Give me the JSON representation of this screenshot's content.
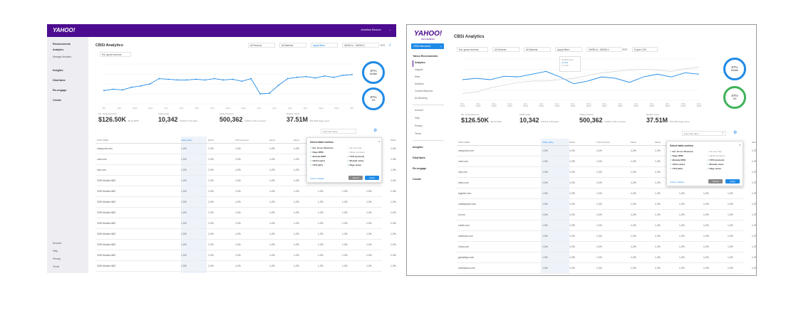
{
  "colors": {
    "brand": "#4d0c8f",
    "accent": "#1f8ae6",
    "donut_mobile": "#1f8ae6",
    "donut_us": "#3fb25a"
  },
  "left": {
    "logo": "YAHOO!",
    "user": "Jonathan Monzon",
    "page_title": "CBSi Analytics",
    "metric_select": "Est. gross revenue",
    "filters": {
      "devices": "All Devices",
      "markets": "All Markets",
      "apply": "Apply filters",
      "date": "06/05/14 - 06/05/14",
      "tz": "EST"
    },
    "nav": {
      "recommends": "Recommends",
      "analytics": "Analytics",
      "manage_modules": "Manage Modules",
      "insights": "Insights",
      "distribute": "Distribute",
      "reengage": "Re-engage",
      "create": "Create",
      "account": "Account",
      "help": "Help",
      "privacy": "Privacy",
      "terms": "Terms"
    },
    "donuts": [
      {
        "value": "87%",
        "label": "Mobile"
      },
      {
        "value": "87%",
        "label": "US"
      }
    ],
    "stats": [
      {
        "label": "Est. Gross Revenue",
        "value": "$126.50K",
        "sub": "$0.16 RPM"
      },
      {
        "label": "Clicks (ads)",
        "value": "10,342",
        "sub": "0.831% CTR (ads)"
      },
      {
        "label": "Clicks (content)",
        "value": "500,362",
        "sub": "0.831% CTR (content)"
      },
      {
        "label": "Module Views",
        "value": "37.51M",
        "sub": "351.00M Page views"
      }
    ],
    "search_placeholder": "enter site name",
    "table": {
      "headers": [
        "SITE NAME",
        "Clicks (ads)",
        "Metric",
        "CTR (content)",
        "Metric",
        "Metric",
        "Metric",
        "Metric",
        "Metric",
        "Metric"
      ],
      "rows": [
        [
          "cbssports.com",
          "1.2%",
          "1.2%",
          "1.2%",
          "1.2%",
          "1.2%",
          "1.2%",
          "1.2%",
          "1.2%",
          "1.2%"
        ],
        [
          "cnet.com",
          "1.2%",
          "1.2%",
          "1.2%",
          "1.2%",
          "1.2%",
          "1.2%",
          "1.2%",
          "1.2%",
          "1.2%"
        ],
        [
          "cbs.com",
          "1.2%",
          "1.2%",
          "1.2%",
          "1.2%",
          "1.2%",
          "1.2%",
          "1.2%",
          "1.2%",
          "1.2%"
        ],
        [
          "CBS Module ABC",
          "1.2%",
          "1.2%",
          "1.2%",
          "1.2%",
          "1.2%",
          "1.2%",
          "1.2%",
          "1.2%",
          "1.2%"
        ],
        [
          "CBS Module ABC",
          "1.2%",
          "1.2%",
          "1.2%",
          "1.2%",
          "1.2%",
          "1.2%",
          "1.2%",
          "1.2%",
          "1.2%"
        ],
        [
          "CBS Module ABC",
          "1.2%",
          "1.2%",
          "1.2%",
          "1.2%",
          "1.2%",
          "1.2%",
          "1.2%",
          "1.2%",
          "1.2%"
        ],
        [
          "CBS Module ABC",
          "1.2%",
          "1.2%",
          "1.2%",
          "1.2%",
          "1.2%",
          "1.2%",
          "1.2%",
          "1.2%",
          "1.2%"
        ],
        [
          "CBS Module ABC",
          "1.2%",
          "1.2%",
          "1.2%",
          "1.2%",
          "1.2%",
          "1.2%",
          "1.2%",
          "1.2%",
          "1.2%"
        ],
        [
          "CBS Module ABC",
          "1.2%",
          "1.2%",
          "1.2%",
          "1.2%",
          "1.2%",
          "1.2%",
          "1.2%",
          "1.2%",
          "1.2%"
        ],
        [
          "CBS Module ABC",
          "1.2%",
          "1.2%",
          "1.2%",
          "1.2%",
          "1.2%",
          "1.2%",
          "1.2%",
          "1.2%",
          "1.2%"
        ],
        [
          "CBS Module ABC",
          "1.2%",
          "1.2%",
          "1.2%",
          "1.2%",
          "1.2%",
          "1.2%",
          "1.2%",
          "1.2%",
          "1.2%"
        ],
        [
          "CBS Module ABC",
          "1.2%",
          "1.2%",
          "1.2%",
          "1.2%",
          "1.2%",
          "1.2%",
          "1.2%",
          "1.2%",
          "1.2%"
        ]
      ]
    },
    "popup": {
      "title": "Select table metrics",
      "items_left": [
        "Est. Gross Revenue",
        "Page RPM",
        "Module RPM",
        "Clicks (ads)",
        "CTR (ads)"
      ],
      "items_right": [
        "Ad view rate",
        "Clicks (content)",
        "CTR (content)",
        "Module views",
        "Page views"
      ],
      "right_checked": [
        false,
        false,
        true,
        true,
        true
      ],
      "reset": "reset to default",
      "cancel": "Cancel",
      "apply": "Apply"
    },
    "x_ticks": [
      "6am",
      "8am",
      "10am",
      "12pm",
      "2pm",
      "4pm",
      "6pm",
      "8pm",
      "10pm",
      "12am",
      "2am",
      "4am",
      "6am",
      "8am",
      "10am",
      "12pm",
      "2pm"
    ]
  },
  "right": {
    "logo": "YAHOO!",
    "logo_sub": "RECOMMENDS",
    "account_select": "CBSi Interactive",
    "page_title": "CBSi Analytics",
    "metric_select": "Est. gross revenue",
    "filters": {
      "devices": "All Devices",
      "markets": "All Markets",
      "apply": "Apply filters",
      "date": "06/05/14 - 06/05/14",
      "tz": "EST",
      "export": "Export CSV"
    },
    "nav": {
      "head": "Yahoo Recommends",
      "items": [
        "Analytics",
        "Insights",
        "Sites",
        "Modules",
        "Content Beacons",
        "Ad Blocking"
      ],
      "items2": [
        "Account",
        "Help",
        "Privacy",
        "Terms"
      ],
      "sections": [
        "Insights",
        "Distribute",
        "Re-engage",
        "Create"
      ]
    },
    "tooltip": {
      "date": "06/05/14 8pm",
      "a": "6,871",
      "b": "4,760"
    },
    "donuts": [
      {
        "value": "87%",
        "label": "Mobile"
      },
      {
        "value": "87%",
        "label": "US"
      }
    ],
    "stats": [
      {
        "label": "Est. Gross Revenue",
        "value": "$126.50K",
        "sub": "$0.16 RPM"
      },
      {
        "label": "Clicks (ads)",
        "value": "10,342",
        "sub": "0.831% CTR (ads)"
      },
      {
        "label": "Clicks (content)",
        "value": "500,362",
        "sub": "0.831% CTR (content)"
      },
      {
        "label": "Module Views",
        "value": "37.51M",
        "sub": "351.00M Page views"
      }
    ],
    "search_placeholder": "enter site name",
    "table": {
      "headers": [
        "SITE NAME",
        "Clicks (ads)",
        "Metric",
        "CTR (content)",
        "Metric",
        "Metric",
        "Metric",
        "Metric",
        "Metric",
        "Metric"
      ],
      "rows": [
        [
          "cbssports.com",
          "1.2%",
          "1.2%",
          "1.2%",
          "1.2%",
          "1.2%",
          "1.2%",
          "1.2%",
          "1.2%",
          "1.2%"
        ],
        [
          "cnet.com",
          "1.2%",
          "1.2%",
          "1.2%",
          "1.2%",
          "1.2%",
          "1.2%",
          "1.2%",
          "1.2%",
          "1.2%"
        ],
        [
          "cbs.com",
          "1.2%",
          "1.2%",
          "1.2%",
          "1.2%",
          "1.2%",
          "1.2%",
          "1.2%",
          "1.2%",
          "1.2%"
        ],
        [
          "radio.com",
          "1.2%",
          "1.2%",
          "1.2%",
          "1.2%",
          "1.2%",
          "1.2%",
          "1.2%",
          "1.2%",
          "1.2%"
        ],
        [
          "tvguide.com",
          "1.2%",
          "1.2%",
          "1.2%",
          "1.2%",
          "1.2%",
          "1.2%",
          "1.2%",
          "1.2%",
          "1.2%"
        ],
        [
          "smartplanet.com",
          "1.2%",
          "1.2%",
          "1.2%",
          "1.2%",
          "1.2%",
          "1.2%",
          "1.2%",
          "1.2%",
          "1.2%"
        ],
        [
          "tv.com",
          "1.2%",
          "1.2%",
          "1.2%",
          "1.2%",
          "1.2%",
          "1.2%",
          "1.2%",
          "1.2%",
          "1.2%"
        ],
        [
          "zdnet.com",
          "1.2%",
          "1.2%",
          "1.2%",
          "1.2%",
          "1.2%",
          "1.2%",
          "1.2%",
          "1.2%",
          "1.2%"
        ],
        [
          "cbsnews.com",
          "1.2%",
          "1.2%",
          "1.2%",
          "1.2%",
          "1.2%",
          "1.2%",
          "1.2%",
          "1.2%",
          "1.2%"
        ],
        [
          "chow.com",
          "1.2%",
          "1.2%",
          "1.2%",
          "1.2%",
          "1.2%",
          "1.2%",
          "1.2%",
          "1.2%",
          "1.2%"
        ],
        [
          "gamefaqs.com",
          "1.2%",
          "1.2%",
          "1.2%",
          "1.2%",
          "1.2%",
          "1.2%",
          "1.2%",
          "1.2%",
          "1.2%"
        ],
        [
          "metrolyrics.com",
          "1.2%",
          "1.2%",
          "1.2%",
          "1.2%",
          "1.2%",
          "1.2%",
          "1.2%",
          "1.2%",
          "1.2%"
        ]
      ]
    },
    "popup": {
      "title": "Select table metrics",
      "items_left": [
        "Est. Gross Revenue",
        "Page RPM",
        "Module RPM",
        "Clicks (ads)",
        "CTR (ads)"
      ],
      "items_right": [
        "Ad view rate",
        "Clicks (content)",
        "CTR (content)",
        "Module views",
        "Page views"
      ],
      "right_checked": [
        false,
        false,
        true,
        true,
        true
      ],
      "reset": "reset to default",
      "cancel": "Cancel",
      "apply": "Apply"
    },
    "x_ticks": [
      "6am",
      "8am",
      "10am",
      "12pm",
      "2pm",
      "4pm",
      "6pm",
      "8pm",
      "10pm",
      "12am",
      "2am",
      "4am",
      "6am",
      "8am",
      "10am",
      "12pm"
    ],
    "x_sub": [
      "06/05",
      "06/05",
      "06/05",
      "06/05",
      "06/05",
      "06/05",
      "06/05",
      "06/05",
      "06/05",
      "06/06",
      "06/06",
      "06/06",
      "06/06",
      "06/06",
      "06/06",
      "06/06"
    ]
  },
  "chart_data": [
    {
      "type": "line",
      "series": [
        {
          "values": [
            20,
            22,
            21,
            25,
            27,
            30,
            38,
            37,
            36,
            36,
            37,
            36,
            38,
            36,
            37,
            34,
            38,
            15,
            16,
            28,
            38,
            40,
            41,
            39,
            42,
            40,
            43,
            44
          ]
        }
      ],
      "ylim": [
        0,
        60
      ]
    },
    {
      "type": "line",
      "series": [
        {
          "values": [
            30,
            32,
            30,
            35,
            34,
            38,
            42,
            34,
            24,
            28,
            34,
            32,
            26,
            34,
            38,
            34,
            40,
            38
          ]
        },
        {
          "values": [
            10,
            12,
            18,
            22,
            26,
            28,
            28,
            30,
            32,
            36,
            40,
            42,
            44,
            45,
            44,
            42,
            46,
            48
          ]
        }
      ],
      "ylim": [
        0,
        60
      ]
    }
  ]
}
